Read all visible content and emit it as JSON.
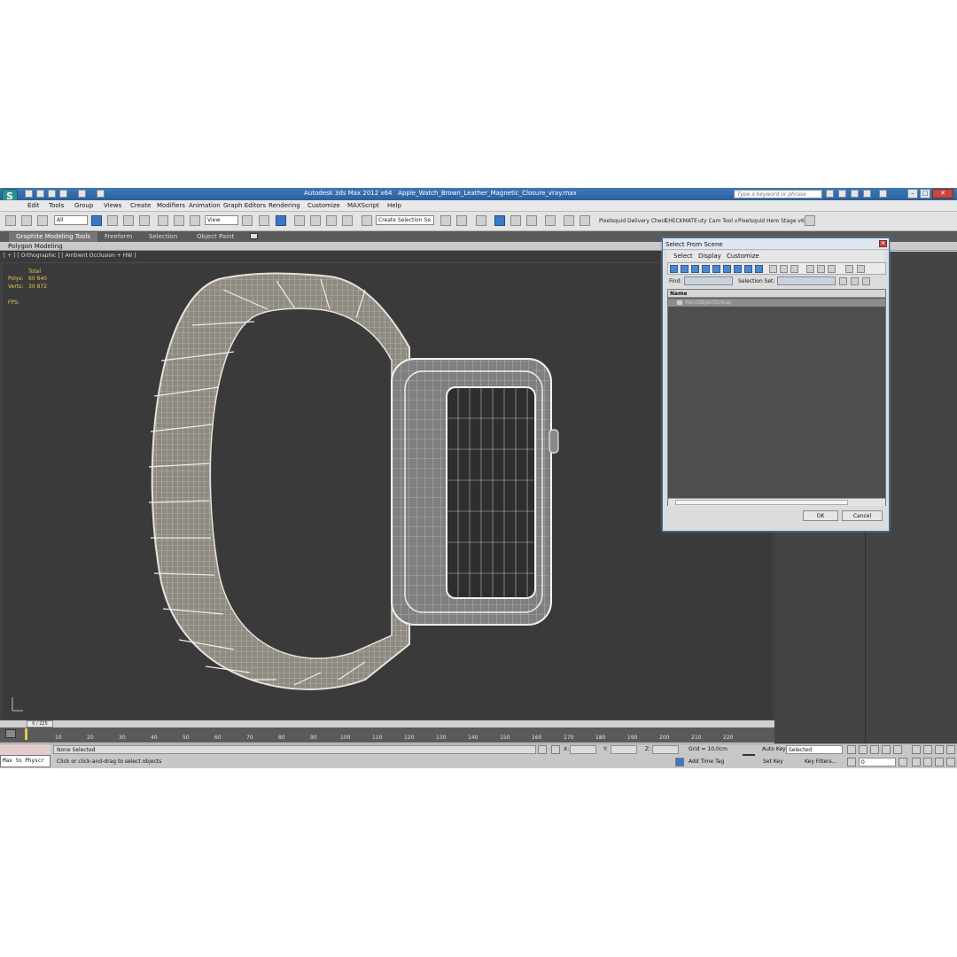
{
  "title_bar": {
    "app_name": "Autodesk 3ds Max  2012 x64",
    "file_name": "Apple_Watch_Brown_Leather_Magnetic_Closure_vray.max",
    "search_placeholder": "Type a keyword or phrase"
  },
  "menu": [
    "Edit",
    "Tools",
    "Group",
    "Views",
    "Create",
    "Modifiers",
    "Animation",
    "Graph Editors",
    "Rendering",
    "Customize",
    "MAXScript",
    "Help"
  ],
  "toolbar": {
    "selection_filter": "All",
    "ref_coord": "View",
    "named_selection": "Create Selection Se",
    "plugins": [
      "Pixelsquid",
      "Delivery Check",
      "CHECKMATE",
      "uty Cam Tool v",
      "Pixelsquid",
      "Hero Stage v6"
    ]
  },
  "ribbon": {
    "tabs": [
      "Graphite Modeling Tools",
      "Freeform",
      "Selection",
      "Object Paint"
    ],
    "subtab": "Polygon Modeling"
  },
  "viewport": {
    "label": "[ + ] [ Orthographic ] [ Ambient Occlusion + HW ]",
    "stats": {
      "header": "Total",
      "polys_label": "Polys:",
      "polys_value": "60 840",
      "verts_label": "Verts:",
      "verts_value": "30 872",
      "fps_label": "FPS:"
    }
  },
  "timeline": {
    "frame": "0 / 225",
    "ticks": [
      "10",
      "20",
      "30",
      "40",
      "50",
      "60",
      "70",
      "80",
      "90",
      "100",
      "110",
      "120",
      "130",
      "140",
      "150",
      "160",
      "170",
      "180",
      "190",
      "200",
      "210",
      "220"
    ]
  },
  "status": {
    "listener": "Max to Physcr",
    "selection": "None Selected",
    "prompt": "Click or click-and-drag to select objects",
    "x_label": "X:",
    "y_label": "Y:",
    "z_label": "Z:",
    "grid": "Grid = 10,0cm",
    "add_time_tag": "Add Time Tag",
    "auto_key": "Auto Key",
    "set_key": "Set Key",
    "key_mode": "Selected",
    "key_filters": "Key Filters...",
    "frame_value": "0"
  },
  "dialog": {
    "title": "Select From Scene",
    "menu": [
      "Select",
      "Display",
      "Customize"
    ],
    "find_label": "Find:",
    "selection_set_label": "Selection Set:",
    "column_name": "Name",
    "items": [
      "HeroObjectGroup"
    ],
    "ok": "OK",
    "cancel": "Cancel"
  }
}
